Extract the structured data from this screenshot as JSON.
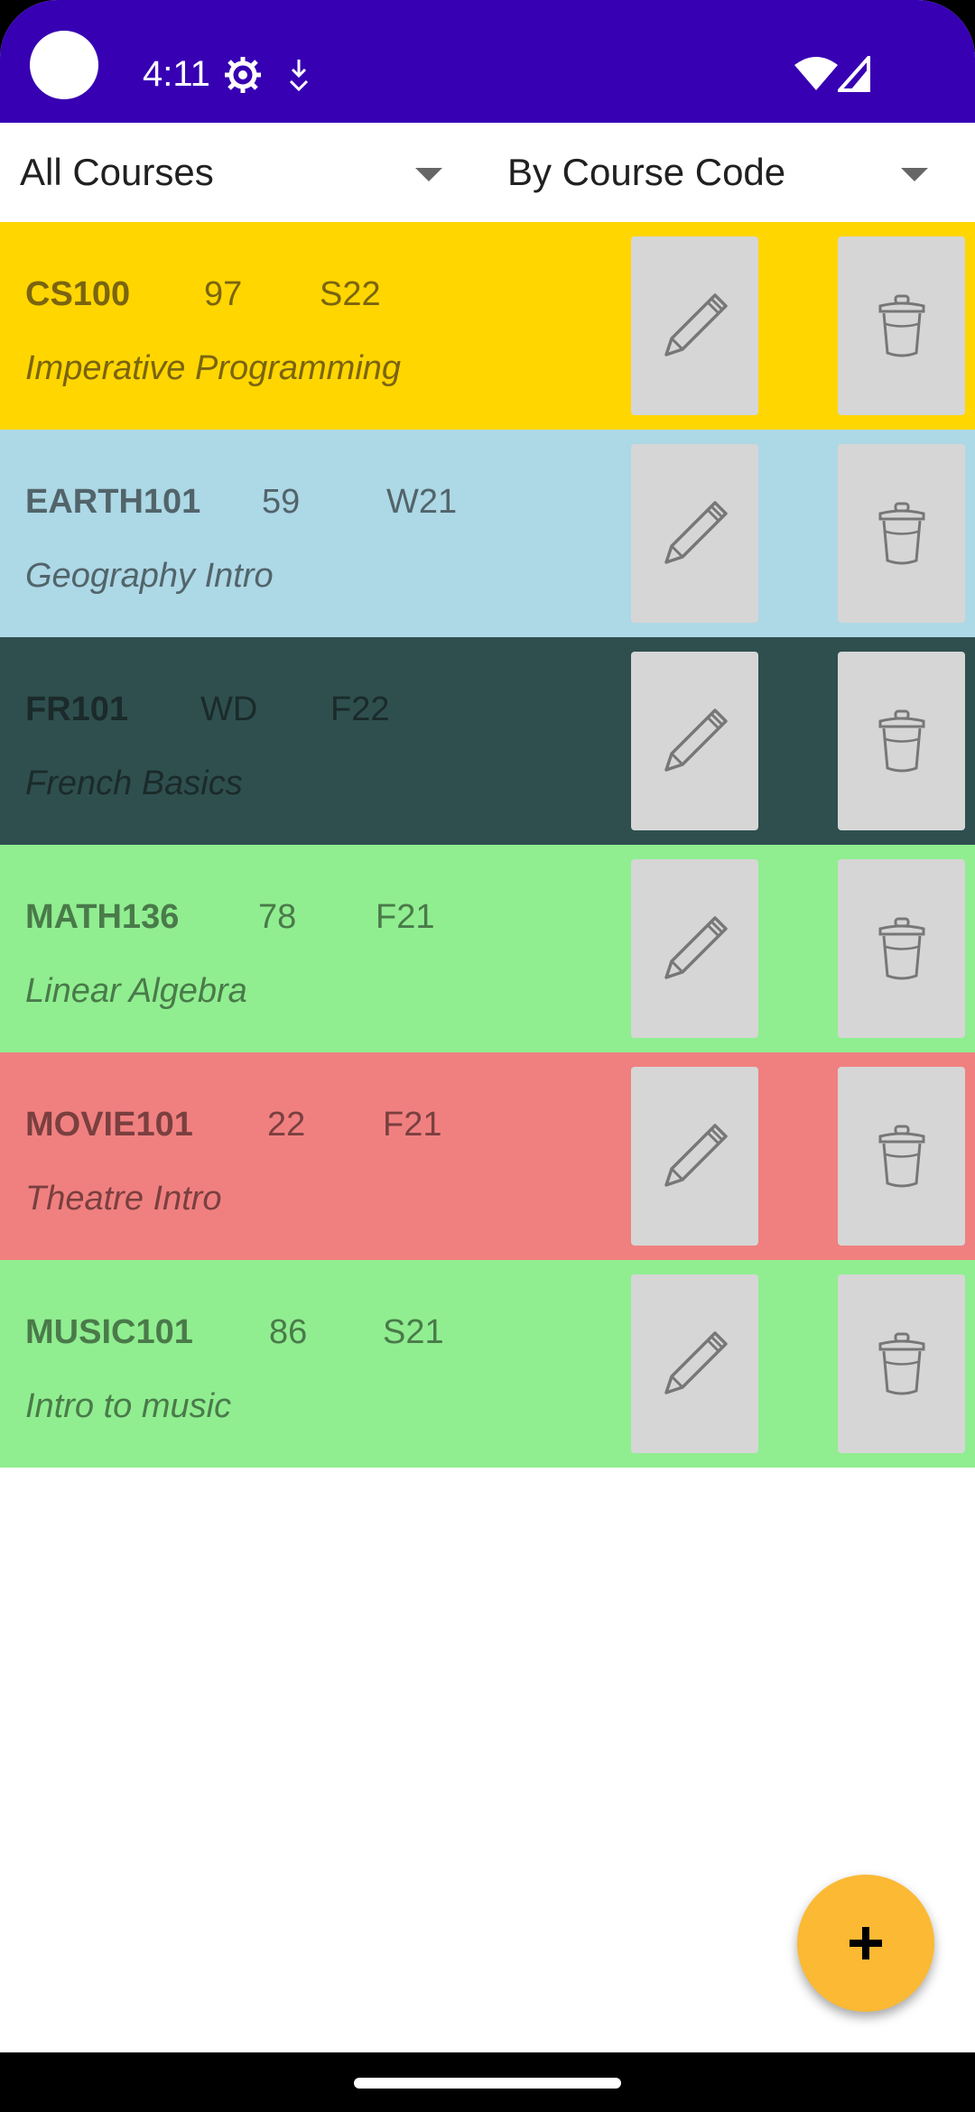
{
  "status_bar": {
    "time": "4:11",
    "icons": [
      "camera-cutout",
      "settings-gear-icon",
      "download-icon",
      "wifi-icon",
      "cell-signal-icon"
    ],
    "background": "#3700b3"
  },
  "filters": {
    "course_filter": "All Courses",
    "sort_order": "By Course Code"
  },
  "courses": [
    {
      "code": "CS100",
      "grade": "97",
      "term": "S22",
      "title": "Imperative Programming",
      "bg": "#ffd600",
      "fg": "#7a6410"
    },
    {
      "code": "EARTH101",
      "grade": "59",
      "term": "W21",
      "title": "Geography Intro",
      "bg": "#add8e6",
      "fg": "#52646a"
    },
    {
      "code": "FR101",
      "grade": "WD",
      "term": "F22",
      "title": "French Basics",
      "bg": "#2f4f4f",
      "fg": "#1b2a2a"
    },
    {
      "code": "MATH136",
      "grade": "78",
      "term": "F21",
      "title": "Linear Algebra",
      "bg": "#90ee90",
      "fg": "#4a7a4a"
    },
    {
      "code": "MOVIE101",
      "grade": "22",
      "term": "F21",
      "title": "Theatre Intro",
      "bg": "#f08080",
      "fg": "#7a3f3f"
    },
    {
      "code": "MUSIC101",
      "grade": "86",
      "term": "S21",
      "title": "Intro to music",
      "bg": "#90ee90",
      "fg": "#4a7a4a"
    }
  ],
  "actions": {
    "edit_icon": "pencil-icon",
    "delete_icon": "trash-icon",
    "fab_icon": "plus-icon",
    "fab_color": "#fbb934"
  }
}
